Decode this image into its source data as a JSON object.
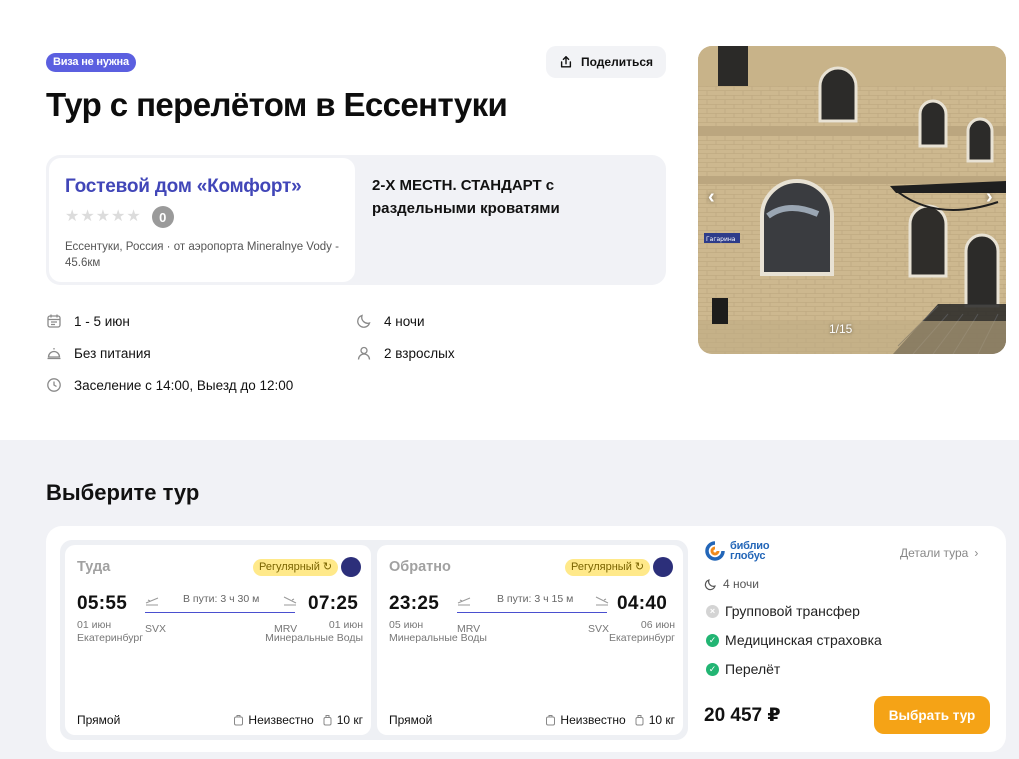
{
  "header": {
    "visa_badge": "Виза не нужна",
    "share_label": "Поделиться",
    "title": "Тур с перелётом в Ессентуки"
  },
  "hotel": {
    "name": "Гостевой дом «Комфорт»",
    "rating": "0",
    "stars_filled": 0,
    "stars_total": 5,
    "location": "Ессентуки, Россия · от аэропорта Mineralnye Vody - 45.6км",
    "room_type": "2-Х МЕСТН. СТАНДАРТ с раздельными кроватями"
  },
  "details": {
    "dates": "1 - 5 июн",
    "nights": "4 ночи",
    "meal": "Без питания",
    "guests": "2 взрослых",
    "checkin": "Заселение с 14:00, Выезд до 12:00"
  },
  "gallery": {
    "counter": "1/15",
    "sign_text": "Гагарина"
  },
  "tours": {
    "section_title": "Выберите тур",
    "tour": {
      "outbound": {
        "title": "Туда",
        "badge": "Регулярный",
        "depart_time": "05:55",
        "arrive_time": "07:25",
        "duration": "В пути: 3 ч 30 м",
        "depart_date": "01 июн",
        "depart_code": "SVX",
        "depart_city": "Екатеринбург",
        "arrive_code": "MRV",
        "arrive_date": "01 июн",
        "arrive_city": "Минеральные Воды",
        "type": "Прямой",
        "baggage_hand": "Неизвестно",
        "baggage_weight": "10 кг"
      },
      "return": {
        "title": "Обратно",
        "badge": "Регулярный",
        "depart_time": "23:25",
        "arrive_time": "04:40",
        "duration": "В пути: 3 ч 15 м",
        "depart_date": "05 июн",
        "depart_code": "MRV",
        "depart_city": "Минеральные Воды",
        "arrive_code": "SVX",
        "arrive_date": "06 июн",
        "arrive_city": "Екатеринбург",
        "type": "Прямой",
        "baggage_hand": "Неизвестно",
        "baggage_weight": "10 кг"
      },
      "operator_line1": "библио",
      "operator_line2": "глобус",
      "details_link": "Детали тура",
      "nights": "4 ночи",
      "features": [
        {
          "label": "Групповой трансфер",
          "included": false
        },
        {
          "label": "Медицинская страховка",
          "included": true
        },
        {
          "label": "Перелёт",
          "included": true
        }
      ],
      "price": "20 457 ₽",
      "select_label": "Выбрать тур"
    }
  },
  "colors": {
    "accent": "#4146b8",
    "badge": "#5b5fe0",
    "button": "#f5a316",
    "success": "#22b573",
    "regular_badge": "#ffe98a"
  }
}
